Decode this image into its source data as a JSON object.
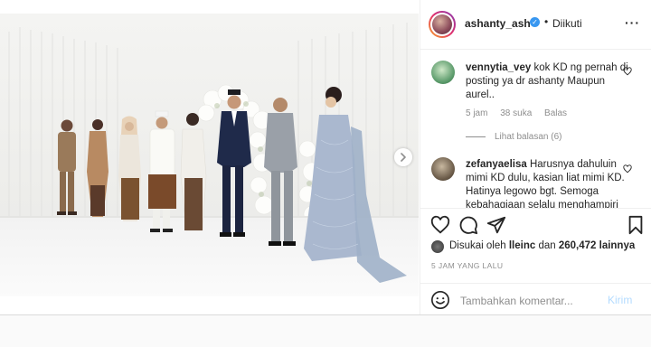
{
  "header": {
    "username": "ashanty_ash",
    "separator": "•",
    "follow_status": "Diikuti",
    "more_icon": "more-horizontal-icon"
  },
  "comments": [
    {
      "username": "vennytia_vey",
      "text": "kok KD ng pernah di posting ya dr ashanty Maupun aurel..",
      "time": "5 jam",
      "likes": "38 suka",
      "reply": "Balas",
      "view_replies": "Lihat balasan (6)"
    },
    {
      "username": "zefanyaelisa",
      "text": "Harusnya dahuluin mimi KD dulu, kasian liat mimi KD. Hatinya legowo bgt. Semoga kebahagiaan selalu menghampiri"
    }
  ],
  "likes": {
    "prefix": "Disukai oleh",
    "user": "lleinc",
    "middle": "dan",
    "count": "260,472 lainnya"
  },
  "time_ago": "5 JAM YANG LALU",
  "compose": {
    "placeholder": "Tambahkan komentar...",
    "post_label": "Kirim"
  },
  "colors": {
    "border": "#dbdbdb",
    "muted": "#8e8e8e",
    "verified": "#3897f0",
    "post_disabled": "#b3dbff"
  }
}
